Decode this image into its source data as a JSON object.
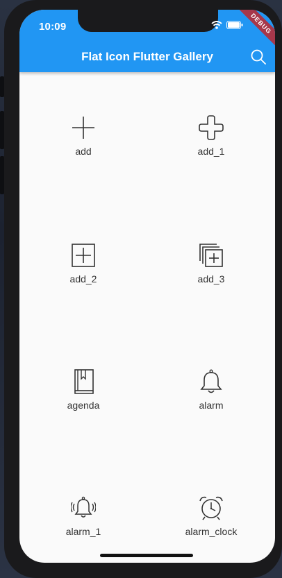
{
  "status_bar": {
    "time": "10:09"
  },
  "debug_banner": "DEBUG",
  "appbar": {
    "title": "Flat Icon Flutter Gallery",
    "search_icon": "search-icon"
  },
  "tiles": [
    {
      "label": "add",
      "icon": "add-icon"
    },
    {
      "label": "add_1",
      "icon": "add-rounded-plus-icon"
    },
    {
      "label": "add_2",
      "icon": "add-square-icon"
    },
    {
      "label": "add_3",
      "icon": "add-stacked-square-icon"
    },
    {
      "label": "agenda",
      "icon": "agenda-book-icon"
    },
    {
      "label": "alarm",
      "icon": "bell-icon"
    },
    {
      "label": "alarm_1",
      "icon": "ringing-bell-icon"
    },
    {
      "label": "alarm_clock",
      "icon": "alarm-clock-icon"
    }
  ],
  "colors": {
    "appbar": "#2196f3",
    "background": "#fafafa",
    "icon_stroke": "#333333",
    "debug": "#a7374a"
  }
}
